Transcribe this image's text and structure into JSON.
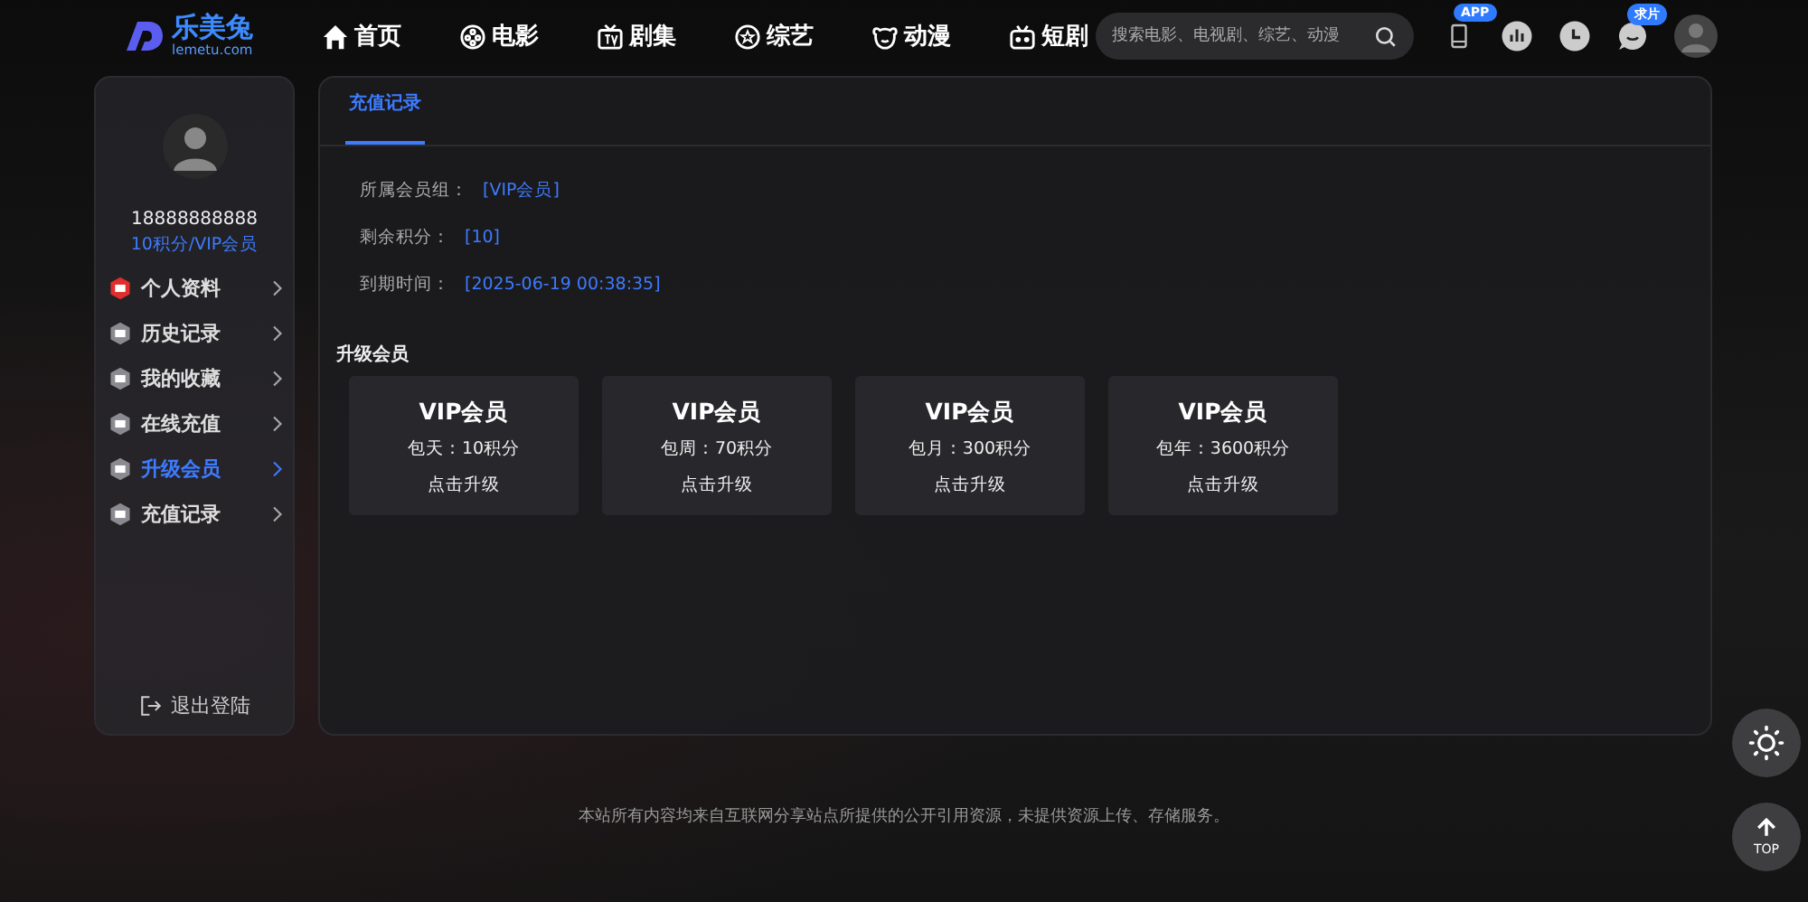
{
  "logo": {
    "name": "乐美兔",
    "domain": "lemetu.com"
  },
  "nav": [
    {
      "label": "首页"
    },
    {
      "label": "电影"
    },
    {
      "label": "剧集"
    },
    {
      "label": "综艺"
    },
    {
      "label": "动漫"
    },
    {
      "label": "短剧"
    }
  ],
  "search": {
    "placeholder": "搜索电影、电视剧、综艺、动漫"
  },
  "app_badge": "APP",
  "request_badge": "求片",
  "user": {
    "phone": "18888888888",
    "status": "10积分/VIP会员"
  },
  "menu": [
    {
      "label": "个人资料",
      "selected": false,
      "color": "#e02d2d"
    },
    {
      "label": "历史记录",
      "selected": false,
      "color": "#8a8a90"
    },
    {
      "label": "我的收藏",
      "selected": false,
      "color": "#8a8a90"
    },
    {
      "label": "在线充值",
      "selected": false,
      "color": "#8a8a90"
    },
    {
      "label": "升级会员",
      "selected": true,
      "color": "#8a8a90"
    },
    {
      "label": "充值记录",
      "selected": false,
      "color": "#8a8a90"
    }
  ],
  "logout": "退出登陆",
  "tabs": [
    {
      "label": "充值记录",
      "selected": true
    }
  ],
  "info": [
    {
      "label": "所属会员组：",
      "value": "[VIP会员]"
    },
    {
      "label": "剩余积分：",
      "value": "[10]"
    },
    {
      "label": "到期时间：",
      "value": "[2025-06-19 00:38:35]"
    }
  ],
  "upgrade_title": "升级会员",
  "plans": [
    {
      "title": "VIP会员",
      "price": "包天：10积分",
      "action": "点击升级"
    },
    {
      "title": "VIP会员",
      "price": "包周：70积分",
      "action": "点击升级"
    },
    {
      "title": "VIP会员",
      "price": "包月：300积分",
      "action": "点击升级"
    },
    {
      "title": "VIP会员",
      "price": "包年：3600积分",
      "action": "点击升级"
    }
  ],
  "footer": "本站所有内容均来自互联网分享站点所提供的公开引用资源，未提供资源上传、存储服务。",
  "top_button": "TOP"
}
